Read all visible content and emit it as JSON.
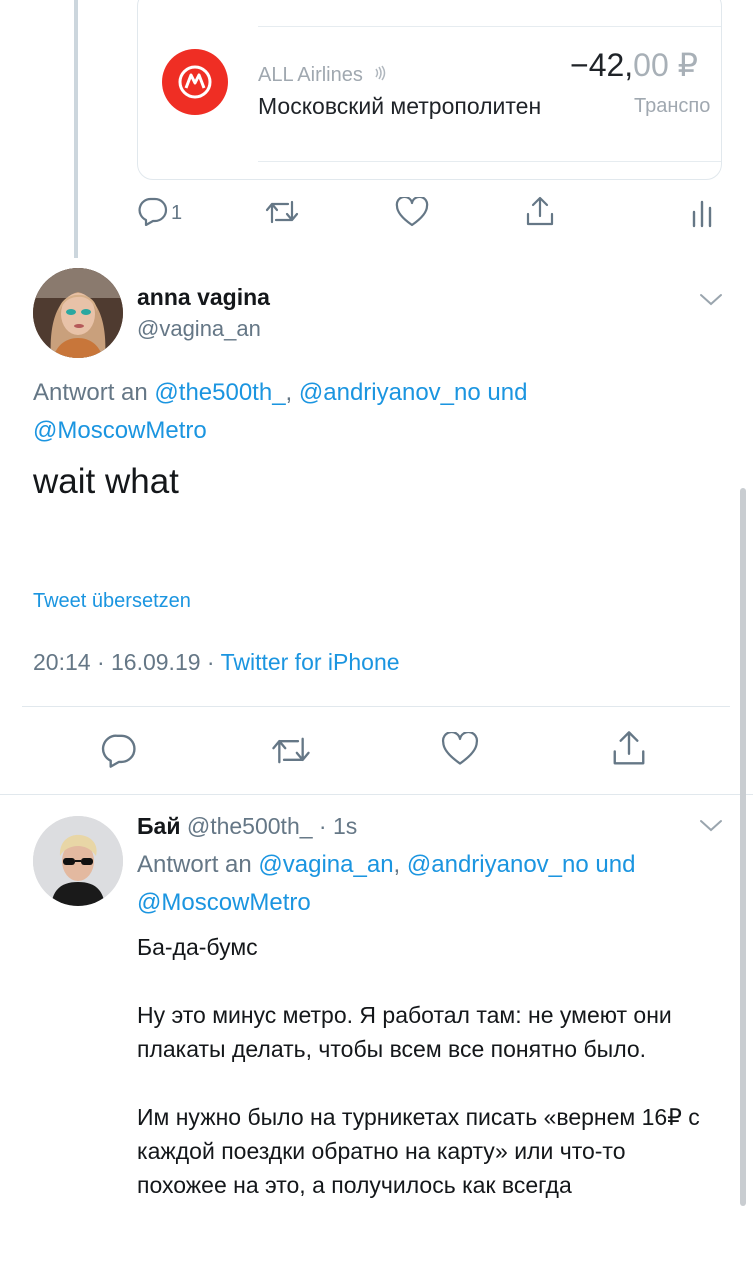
{
  "embedded_card": {
    "merchant_line": "ALL Airlines",
    "merchant_name": "Московский метрополитен",
    "amount_main": "−42,",
    "amount_decimals": "00 ₽",
    "category": "Транспо"
  },
  "prev_actions": {
    "reply_count": "1"
  },
  "tweet": {
    "display_name": "anna vagina",
    "handle": "@vagina_an",
    "reply_prefix": "Antwort an ",
    "mention1": "@the500th_",
    "sep1": ", ",
    "mention2": "@andriyanov_no",
    "and_word": " und",
    "mention3": "@MoscowMetro",
    "text": "wait what",
    "translate": "Tweet übersetzen",
    "time": "20:14 · 16.09.19 · ",
    "source": "Twitter for iPhone"
  },
  "reply": {
    "display_name": "Бай",
    "handle_time": " @the500th_ · 1s",
    "reply_prefix": "Antwort an ",
    "mention1": "@vagina_an",
    "sep1": ", ",
    "mention2": "@andriyanov_no",
    "and_word": " und",
    "mention3": "@MoscowMetro",
    "para1": "Ба-да-бумс",
    "para2": "Ну это минус метро. Я работал там: не умеют они плакаты делать, чтобы всем все понятно было.",
    "para3": "Им нужно было на турникетах писать «вернем 16₽ с каждой поездки обратно на карту» или что-то похожее на это, а получилось как всегда"
  },
  "colors": {
    "link": "#1b95e0",
    "secondary": "#657786",
    "metro_red": "#ef2e24"
  },
  "icons": [
    "reply-icon",
    "retweet-icon",
    "like-icon",
    "share-icon",
    "analytics-icon",
    "chevron-down-icon",
    "metro-logo-icon",
    "contactless-icon"
  ]
}
